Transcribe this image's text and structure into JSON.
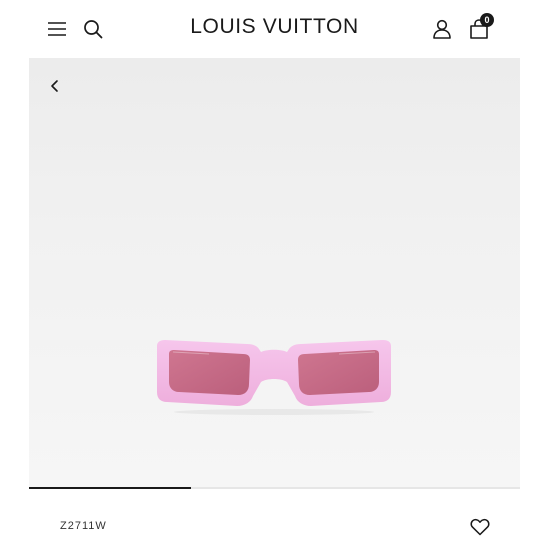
{
  "header": {
    "logo_text": "LOUIS VUITTON",
    "menu_icon": "hamburger-menu-icon",
    "search_icon": "search-icon",
    "account_icon": "user-icon",
    "cart_icon": "shopping-bag-icon",
    "cart_count": "0"
  },
  "gallery": {
    "back_icon": "chevron-left-icon",
    "image_subject": "pink rectangular sunglasses",
    "progress": 0.33
  },
  "product": {
    "sku": "Z2711W",
    "wishlist_icon": "heart-icon"
  },
  "colors": {
    "text": "#1a1a1a",
    "frame_pink": "#f2b7e3",
    "lens_pink": "#c96a86",
    "hero_bg": "#efefef"
  }
}
